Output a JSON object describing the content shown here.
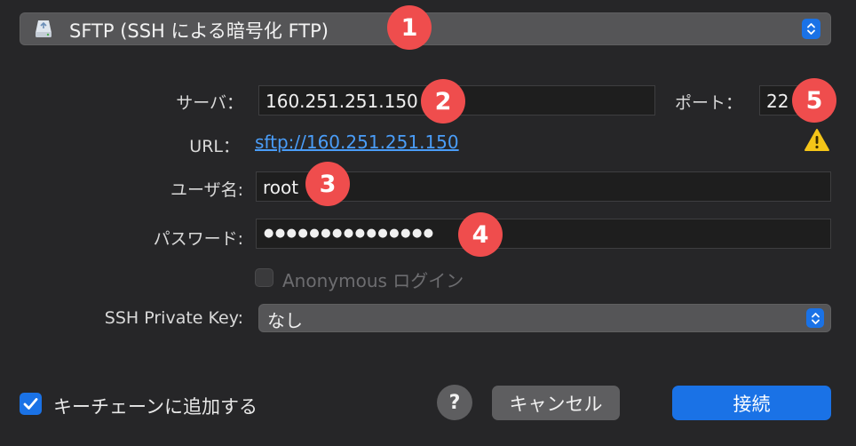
{
  "protocol": {
    "label": "SFTP (SSH による暗号化 FTP)"
  },
  "server": {
    "label": "サーバ：",
    "value": "160.251.251.150"
  },
  "port": {
    "label": "ポート：",
    "value": "22"
  },
  "url": {
    "label": "URL：",
    "value": "sftp://160.251.251.150"
  },
  "username": {
    "label": "ユーザ名:",
    "value": "root"
  },
  "password": {
    "label": "パスワード:",
    "masked": "●●●●●●●●●●●●●●●"
  },
  "anonymous": {
    "label": "Anonymous ログイン",
    "checked": false,
    "enabled": false
  },
  "ssh_key": {
    "label": "SSH Private Key:",
    "value": "なし"
  },
  "keychain": {
    "label": "キーチェーンに追加する",
    "checked": true
  },
  "buttons": {
    "help": "?",
    "cancel": "キャンセル",
    "connect": "接続"
  },
  "badges": [
    "1",
    "2",
    "3",
    "4",
    "5"
  ],
  "colors": {
    "accent": "#1a72e6",
    "badge": "#ef4d4d",
    "link": "#4a9df8",
    "warning": "#f5c518"
  }
}
